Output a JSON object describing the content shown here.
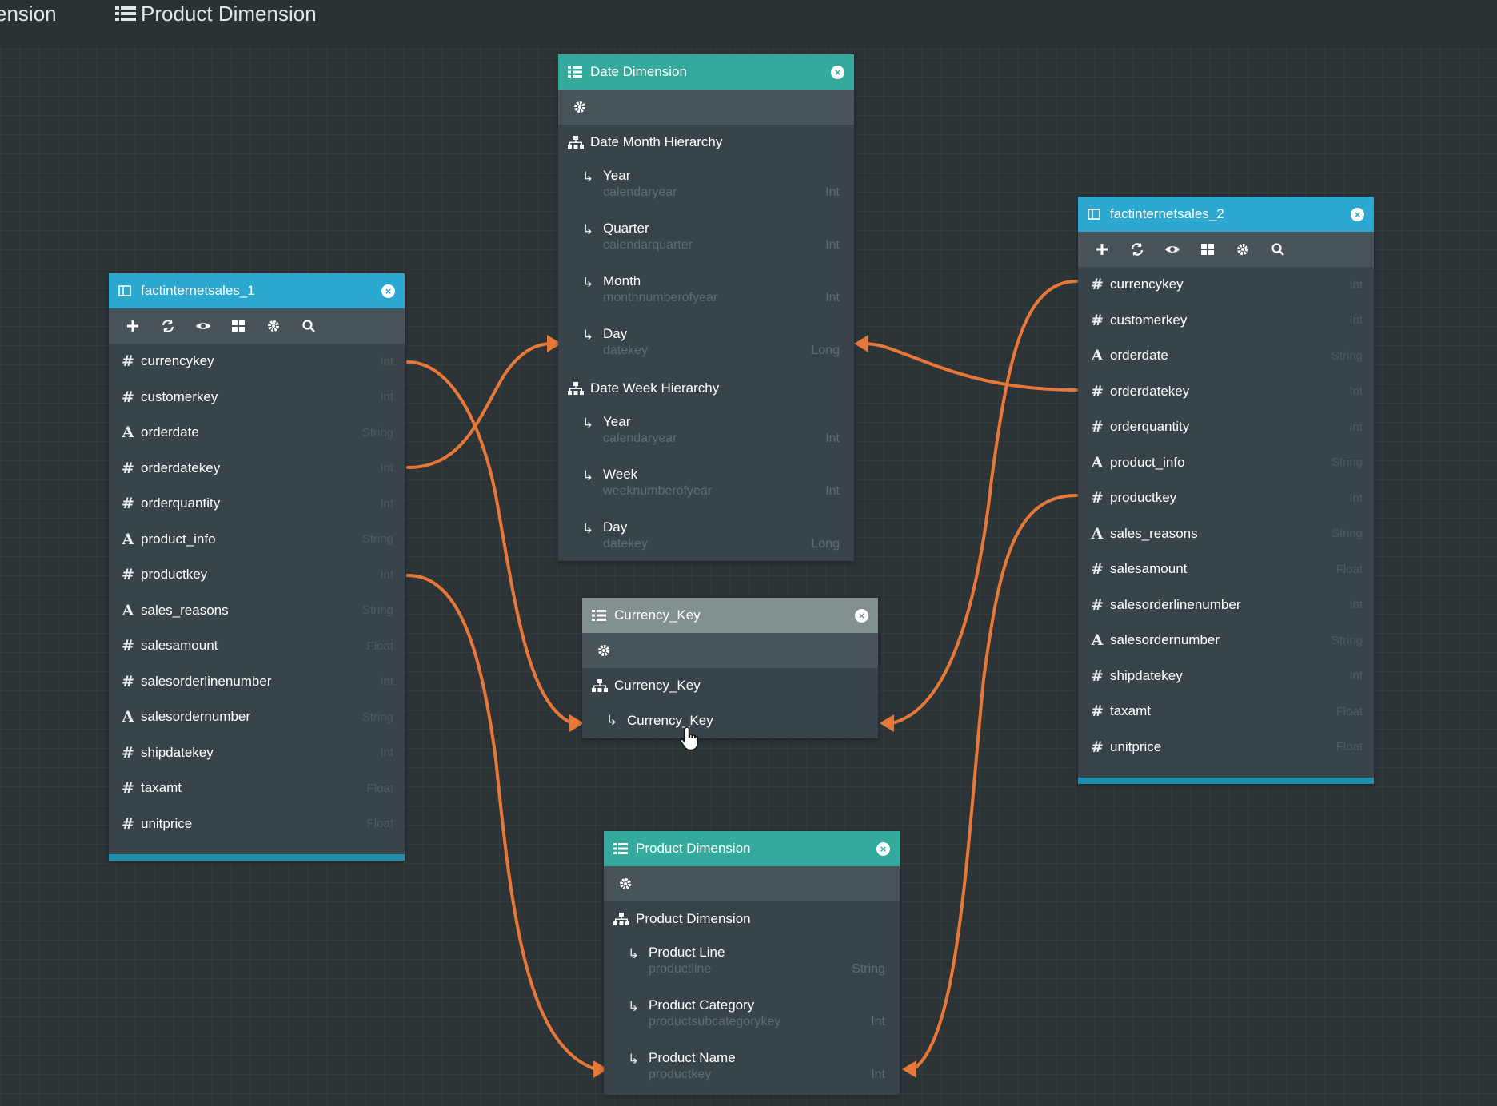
{
  "top_tabs": [
    "ension",
    "Product Dimension"
  ],
  "colors": {
    "link": "#e8783a",
    "fact_header": "#2aa8cf",
    "dim_header": "#34aa9c",
    "selected_header": "#82918f"
  },
  "fact_fields": [
    {
      "type": "#",
      "name": "currencykey",
      "dtype": "Int"
    },
    {
      "type": "#",
      "name": "customerkey",
      "dtype": "Int"
    },
    {
      "type": "A",
      "name": "orderdate",
      "dtype": "String"
    },
    {
      "type": "#",
      "name": "orderdatekey",
      "dtype": "Int"
    },
    {
      "type": "#",
      "name": "orderquantity",
      "dtype": "Int"
    },
    {
      "type": "A",
      "name": "product_info",
      "dtype": "String"
    },
    {
      "type": "#",
      "name": "productkey",
      "dtype": "Int"
    },
    {
      "type": "A",
      "name": "sales_reasons",
      "dtype": "String"
    },
    {
      "type": "#",
      "name": "salesamount",
      "dtype": "Float"
    },
    {
      "type": "#",
      "name": "salesorderlinenumber",
      "dtype": "Int"
    },
    {
      "type": "A",
      "name": "salesordernumber",
      "dtype": "String"
    },
    {
      "type": "#",
      "name": "shipdatekey",
      "dtype": "Int"
    },
    {
      "type": "#",
      "name": "taxamt",
      "dtype": "Float"
    },
    {
      "type": "#",
      "name": "unitprice",
      "dtype": "Float"
    }
  ],
  "fact1": {
    "title": "factinternetsales_1"
  },
  "fact2": {
    "title": "factinternetsales_2"
  },
  "date_dim": {
    "title": "Date Dimension",
    "hier1": {
      "title": "Date Month Hierarchy",
      "levels": [
        {
          "name": "Year",
          "column": "calendaryear",
          "dtype": "Int"
        },
        {
          "name": "Quarter",
          "column": "calendarquarter",
          "dtype": "Int"
        },
        {
          "name": "Month",
          "column": "monthnumberofyear",
          "dtype": "Int"
        },
        {
          "name": "Day",
          "column": "datekey",
          "dtype": "Long"
        }
      ]
    },
    "hier2": {
      "title": "Date Week Hierarchy",
      "levels": [
        {
          "name": "Year",
          "column": "calendaryear",
          "dtype": "Int"
        },
        {
          "name": "Week",
          "column": "weeknumberofyear",
          "dtype": "Int"
        },
        {
          "name": "Day",
          "column": "datekey",
          "dtype": "Long"
        }
      ]
    }
  },
  "currency_dim": {
    "title": "Currency_Key",
    "hier_title": "Currency_Key",
    "level": "Currency_Key"
  },
  "product_dim": {
    "title": "Product Dimension",
    "hier_title": "Product Dimension",
    "levels": [
      {
        "name": "Product Line",
        "column": "productline",
        "dtype": "String"
      },
      {
        "name": "Product Category",
        "column": "productsubcategorykey",
        "dtype": "Int"
      },
      {
        "name": "Product Name",
        "column": "productkey",
        "dtype": "Int"
      }
    ]
  }
}
